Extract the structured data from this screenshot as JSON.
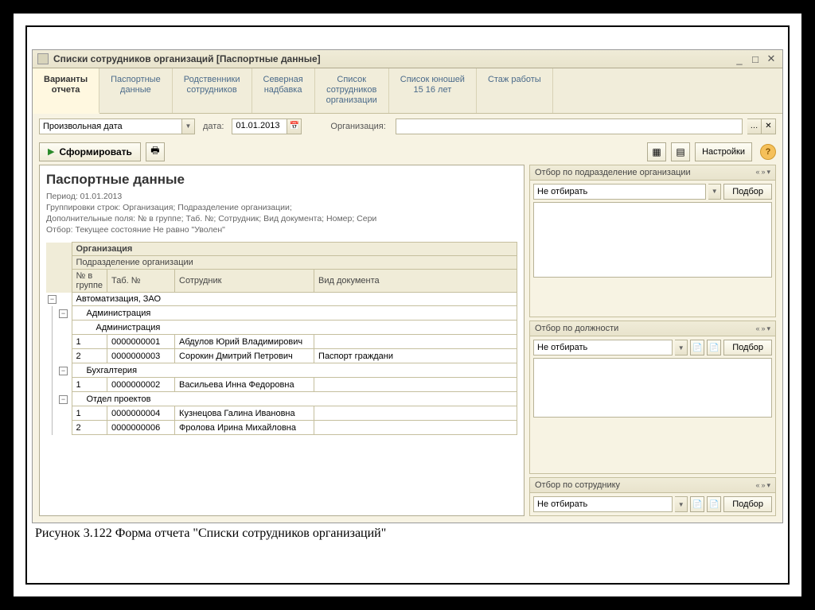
{
  "window": {
    "title": "Списки сотрудников организаций [Паспортные данные]"
  },
  "tabs": [
    {
      "label": "Варианты\nотчета",
      "active": true
    },
    {
      "label": "Паспортные\nданные",
      "active": false
    },
    {
      "label": "Родственники\nсотрудников",
      "active": false
    },
    {
      "label": "Северная\nнадбавка",
      "active": false
    },
    {
      "label": "Список\nсотрудников\nорганизации",
      "active": false
    },
    {
      "label": "Список юношей\n15 16 лет",
      "active": false
    },
    {
      "label": "Стаж работы",
      "active": false
    }
  ],
  "toolbar": {
    "period_mode": "Произвольная дата",
    "date_label": "дата:",
    "date_value": "01.01.2013",
    "org_label": "Организация:",
    "org_value": "",
    "form_button": "Сформировать",
    "settings_button": "Настройки"
  },
  "report": {
    "title": "Паспортные данные",
    "period_line": "Период: 01.01.2013",
    "group_line": "Группировки строк: Организация; Подразделение организации;",
    "fields_line": "Дополнительные поля: № в группе; Таб. №; Сотрудник; Вид документа; Номер; Сери",
    "filter_line": "Отбор: Текущее состояние Не равно \"Уволен\"",
    "hdr_org": "Организация",
    "hdr_dept": "Подразделение организации",
    "col_num": "№ в группе",
    "col_tab": "Таб. №",
    "col_emp": "Сотрудник",
    "col_doc": "Вид документа",
    "tree": {
      "org": "Автоматизация, ЗАО",
      "dept1": "Администрация",
      "dept1_sub": "Администрация",
      "rows1": [
        {
          "n": "1",
          "tab": "0000000001",
          "emp": "Абдулов Юрий Владимирович",
          "doc": ""
        },
        {
          "n": "2",
          "tab": "0000000003",
          "emp": "Сорокин Дмитрий Петрович",
          "doc": "Паспорт граждани"
        }
      ],
      "dept2": "Бухгалтерия",
      "rows2": [
        {
          "n": "1",
          "tab": "0000000002",
          "emp": "Васильева Инна Федоровна",
          "doc": ""
        }
      ],
      "dept3": "Отдел проектов",
      "rows3": [
        {
          "n": "1",
          "tab": "0000000004",
          "emp": "Кузнецова Галина Ивановна",
          "doc": ""
        },
        {
          "n": "2",
          "tab": "0000000006",
          "emp": "Фролова Ирина Михайловна",
          "doc": ""
        }
      ]
    }
  },
  "filters": {
    "f1_title": "Отбор по подразделение организации",
    "f2_title": "Отбор по должности",
    "f3_title": "Отбор по сотруднику",
    "not_filter": "Не отбирать",
    "podbor": "Подбор"
  },
  "caption": "Рисунок 3.122 Форма отчета \"Списки сотрудников организаций\""
}
